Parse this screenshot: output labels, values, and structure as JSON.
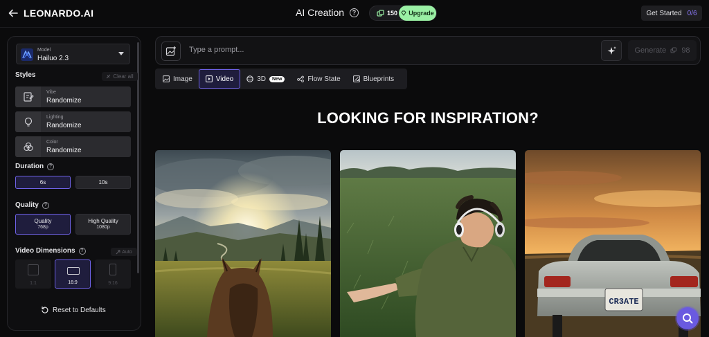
{
  "topbar": {
    "logo": "LEONARDO.AI",
    "title": "AI Creation",
    "credits": "150",
    "upgrade_label": "Upgrade",
    "get_started_label": "Get Started",
    "get_started_count": "0/6"
  },
  "sidebar": {
    "model": {
      "label": "Model",
      "value": "Hailuo 2.3"
    },
    "styles": {
      "heading": "Styles",
      "clear_label": "Clear all",
      "items": [
        {
          "caption": "Vibe",
          "value": "Randomize",
          "icon": "vibe-icon"
        },
        {
          "caption": "Lighting",
          "value": "Randomize",
          "icon": "lightbulb-icon"
        },
        {
          "caption": "Color",
          "value": "Randomize",
          "icon": "color-circles-icon"
        }
      ]
    },
    "duration": {
      "heading": "Duration",
      "options": [
        "6s",
        "10s"
      ],
      "selected": "6s"
    },
    "quality": {
      "heading": "Quality",
      "options": [
        {
          "label": "Quality",
          "sub": "768p"
        },
        {
          "label": "High Quality",
          "sub": "1080p"
        }
      ],
      "selected": "Quality"
    },
    "dimensions": {
      "heading": "Video Dimensions",
      "auto_label": "Auto",
      "options": [
        "1:1",
        "16:9",
        "9:16"
      ],
      "selected": "16:9"
    },
    "reset_label": "Reset to Defaults"
  },
  "prompt": {
    "placeholder": "Type a prompt...",
    "generate_label": "Generate",
    "generate_cost": "98"
  },
  "tabs": [
    {
      "label": "Image",
      "icon": "image-icon"
    },
    {
      "label": "Video",
      "icon": "video-icon",
      "active": true
    },
    {
      "label": "3D",
      "icon": "cube-icon",
      "badge": "New"
    },
    {
      "label": "Flow State",
      "icon": "flow-icon"
    },
    {
      "label": "Blueprints",
      "icon": "blueprint-icon"
    }
  ],
  "main": {
    "headline": "LOOKING FOR INSPIRATION?",
    "cards": [
      {
        "subject": "horse-meadow-sunset"
      },
      {
        "subject": "man-headphones-field"
      },
      {
        "subject": "classic-car-sunset",
        "plate_text": "CR3ATE"
      }
    ]
  },
  "colors": {
    "accent": "#6f62e8",
    "upgrade": "#9af0a4",
    "background": "#0b0b0c"
  }
}
